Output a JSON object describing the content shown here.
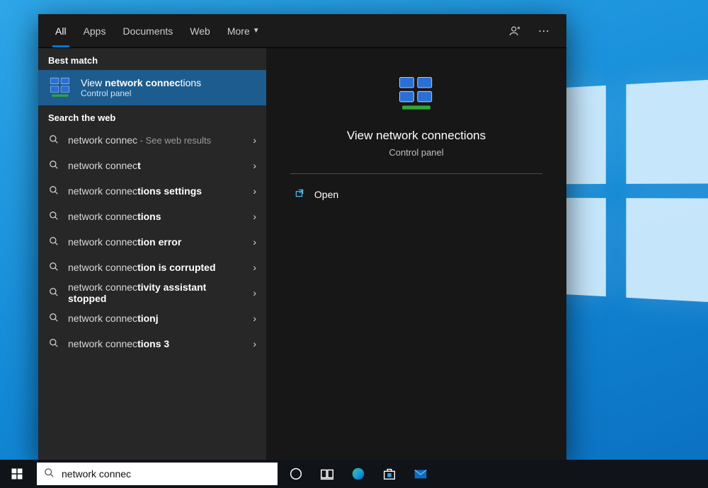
{
  "tabs": {
    "all": "All",
    "apps": "Apps",
    "documents": "Documents",
    "web": "Web",
    "more": "More"
  },
  "sections": {
    "best_match": "Best match",
    "search_web": "Search the web"
  },
  "best_match": {
    "title_prefix": "View ",
    "title_bold": "network connec",
    "title_suffix": "tions",
    "subtitle": "Control panel"
  },
  "web_results": [
    {
      "bold": "network connec",
      "rest": "",
      "suffix_label": " - See web results"
    },
    {
      "bold": "network connec",
      "rest": "t",
      "suffix_label": ""
    },
    {
      "bold": "network connec",
      "rest": "tions settings",
      "suffix_label": ""
    },
    {
      "bold": "network connec",
      "rest": "tions",
      "suffix_label": ""
    },
    {
      "bold": "network connec",
      "rest": "tion error",
      "suffix_label": ""
    },
    {
      "bold": "network connec",
      "rest": "tion is corrupted",
      "suffix_label": ""
    },
    {
      "bold": "network connec",
      "rest": "tivity assistant stopped",
      "suffix_label": ""
    },
    {
      "bold": "network connec",
      "rest": "tionj",
      "suffix_label": ""
    },
    {
      "bold": "network connec",
      "rest": "tions 3",
      "suffix_label": ""
    }
  ],
  "preview": {
    "title": "View network connections",
    "subtitle": "Control panel",
    "open": "Open"
  },
  "search": {
    "value": "network connec"
  }
}
